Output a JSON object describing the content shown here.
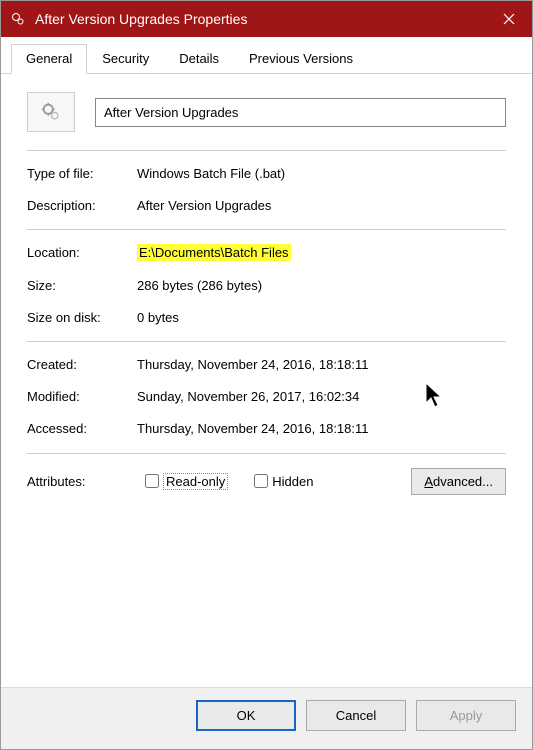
{
  "titlebar": {
    "title": "After Version Upgrades Properties"
  },
  "tabs": {
    "general": "General",
    "security": "Security",
    "details": "Details",
    "previous": "Previous Versions"
  },
  "file": {
    "name": "After Version Upgrades"
  },
  "labels": {
    "type_of_file": "Type of file:",
    "description": "Description:",
    "location": "Location:",
    "size": "Size:",
    "size_on_disk": "Size on disk:",
    "created": "Created:",
    "modified": "Modified:",
    "accessed": "Accessed:",
    "attributes": "Attributes:"
  },
  "values": {
    "type_of_file": "Windows Batch File (.bat)",
    "description": "After Version Upgrades",
    "location": "E:\\Documents\\Batch Files",
    "size": "286 bytes (286 bytes)",
    "size_on_disk": "0 bytes",
    "created": "Thursday, November 24, 2016, 18:18:11",
    "modified": "Sunday, November 26, 2017, 16:02:34",
    "accessed": "Thursday, November 24, 2016, 18:18:11"
  },
  "attributes": {
    "read_only": "Read-only",
    "hidden": "Hidden"
  },
  "buttons": {
    "advanced_prefix": "A",
    "advanced_rest": "dvanced...",
    "ok": "OK",
    "cancel": "Cancel",
    "apply": "Apply"
  }
}
